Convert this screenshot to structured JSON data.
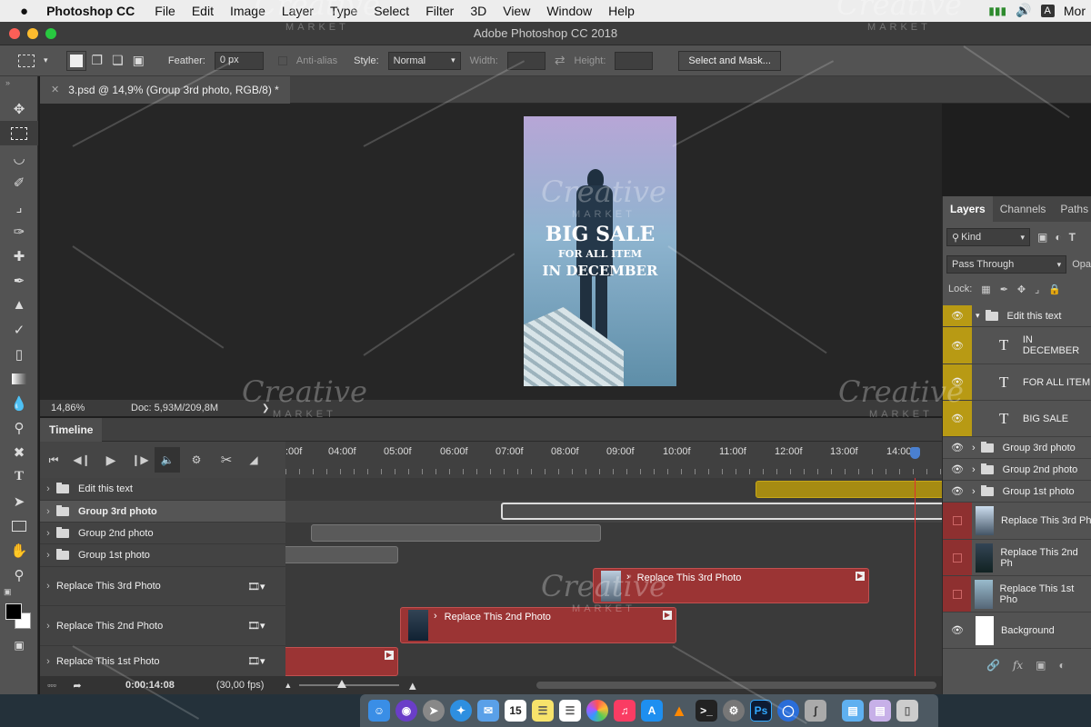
{
  "menubar": {
    "app": "Photoshop CC",
    "items": [
      "File",
      "Edit",
      "Image",
      "Layer",
      "Type",
      "Select",
      "Filter",
      "3D",
      "View",
      "Window",
      "Help"
    ],
    "right_text": "A",
    "user": "Mor"
  },
  "window": {
    "title": "Adobe Photoshop CC 2018"
  },
  "options": {
    "feather_label": "Feather:",
    "feather_value": "0 px",
    "antialias_label": "Anti-alias",
    "style_label": "Style:",
    "style_value": "Normal",
    "width_label": "Width:",
    "height_label": "Height:",
    "select_mask": "Select and Mask..."
  },
  "doc_tab": {
    "label": "3.psd @ 14,9% (Group 3rd photo, RGB/8) *"
  },
  "artboard": {
    "line1": "BIG SALE",
    "line2": "FOR ALL ITEM",
    "line3": "IN DECEMBER"
  },
  "status": {
    "zoom": "14,86%",
    "doc": "Doc: 5,93M/209,8M"
  },
  "timeline": {
    "title": "Timeline",
    "ruler": ":00f|04:00f|05:00f|06:00f|07:00f|08:00f|09:00f|10:00f|11:00f|12:00f|13:00f|14:00f",
    "ruler_ticks": [
      ":00f",
      "04:00f",
      "05:00f",
      "06:00f",
      "07:00f",
      "08:00f",
      "09:00f",
      "10:00f",
      "11:00f",
      "12:00f",
      "13:00f",
      "14:00f"
    ],
    "tracks": {
      "edit_text": "Edit this text",
      "group3": "Group 3rd photo",
      "group2": "Group 2nd photo",
      "group1": "Group 1st photo",
      "replace3": "Replace This 3rd Photo",
      "replace2": "Replace This 2nd Photo",
      "replace1": "Replace This 1st Photo"
    },
    "clips": {
      "replace3": "Replace This 3rd Photo",
      "replace2": "Replace This 2nd Photo"
    },
    "timecode": "0:00:14:08",
    "fps": "(30,00 fps)"
  },
  "layers": {
    "tabs": [
      "Layers",
      "Channels",
      "Paths"
    ],
    "kind": "Kind",
    "blend": "Pass Through",
    "opacity_label": "Opa",
    "lock_label": "Lock:",
    "rows": {
      "group_edit": "Edit this text",
      "t1": "IN DECEMBER",
      "t2": "FOR ALL ITEM",
      "t3": "BIG SALE",
      "g3": "Group 3rd photo",
      "g2": "Group 2nd photo",
      "g1": "Group 1st photo",
      "r3": "Replace This 3rd Ph",
      "r2": "Replace This 2nd Ph",
      "r1": "Replace This 1st Pho",
      "bg": "Background"
    },
    "footer": {
      "fx": "fx"
    }
  },
  "dock": {
    "cal_day": "15",
    "ps_label": "Ps"
  },
  "watermark": {
    "main": "Creative",
    "sub": "MARKET"
  },
  "colors": {
    "accent_yellow": "#b89a14",
    "clip_red": "#9b3434",
    "playhead": "#e03030"
  }
}
